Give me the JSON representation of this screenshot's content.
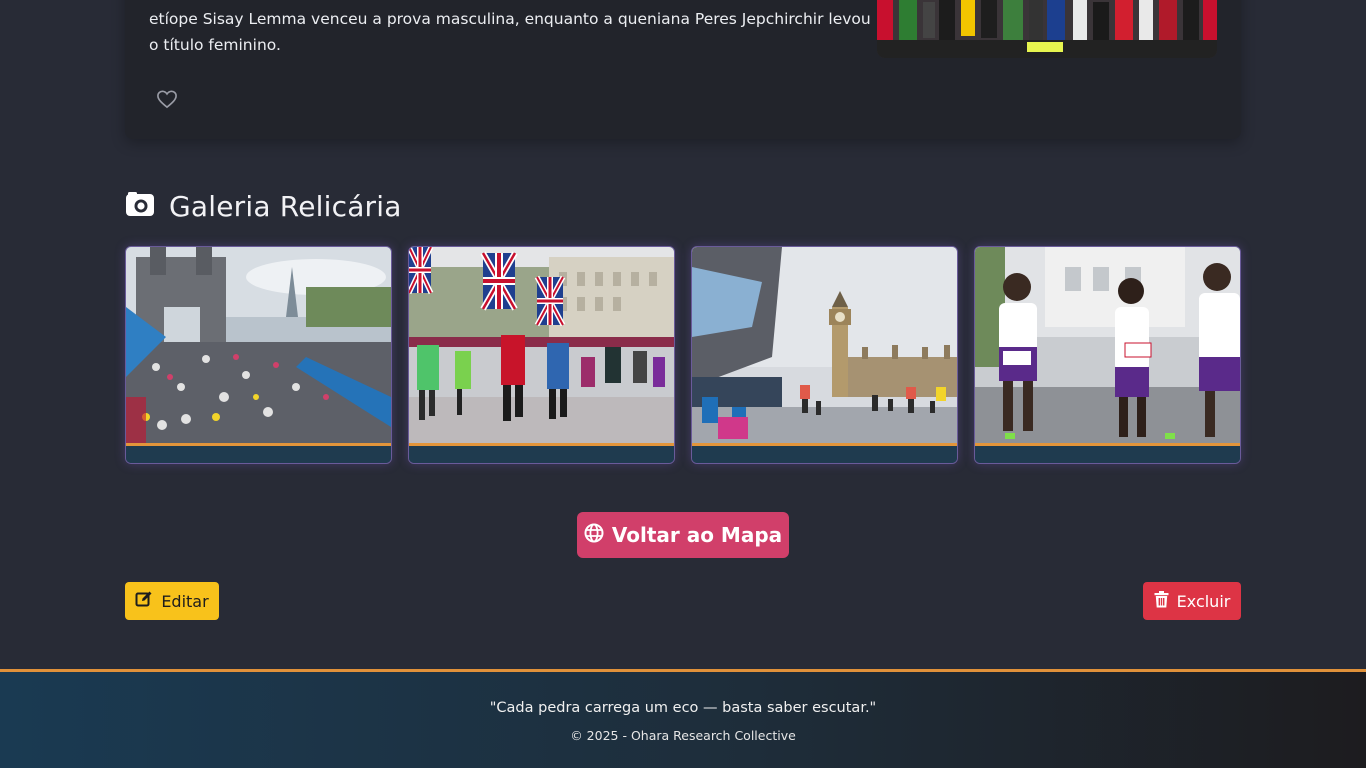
{
  "article": {
    "text_line_1": "etíope Sisay Lemma venceu a prova masculina, enquanto a queniana Peres Jepchirchir levou",
    "text_line_2": "o título feminino."
  },
  "gallery": {
    "title": "Galeria Relicária",
    "icon": "camera-icon"
  },
  "actions": {
    "back_to_map": "Voltar ao Mapa",
    "edit": "Editar",
    "delete": "Excluir"
  },
  "footer": {
    "quote": "\"Cada pedra carrega um eco — basta saber escutar.\"",
    "copyright": "© 2025 - Ohara Research Collective"
  },
  "colors": {
    "page_bg": "#282b36",
    "primary_button": "#d13f6a",
    "edit_button": "#f8c21b",
    "delete_button": "#dd3445",
    "accent_bar": "#e3953a"
  }
}
